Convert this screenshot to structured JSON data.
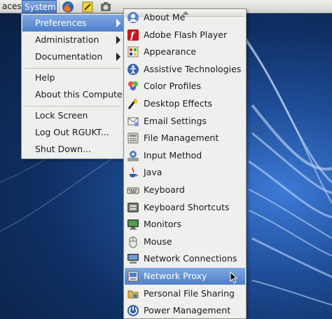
{
  "panel": {
    "places_label": "aces",
    "system_label": "System",
    "launchers": [
      {
        "name": "firefox-icon"
      },
      {
        "name": "text-editor-icon"
      },
      {
        "name": "screenshot-icon"
      }
    ]
  },
  "system_menu": {
    "items": [
      {
        "label": "Preferences",
        "submenu": true,
        "active": true
      },
      {
        "label": "Administration",
        "submenu": true
      },
      {
        "label": "Documentation",
        "submenu": true
      },
      {
        "label": "Help"
      },
      {
        "label": "About this Computer"
      },
      {
        "label": "Lock Screen"
      },
      {
        "label": "Log Out RGUKT..."
      },
      {
        "label": "Shut Down..."
      }
    ]
  },
  "preferences_menu": {
    "items": [
      {
        "label": "About Me",
        "icon": "about-me-icon"
      },
      {
        "label": "Adobe Flash Player",
        "icon": "flash-player-icon"
      },
      {
        "label": "Appearance",
        "icon": "appearance-icon"
      },
      {
        "label": "Assistive Technologies",
        "icon": "accessibility-icon"
      },
      {
        "label": "Color Profiles",
        "icon": "color-profiles-icon"
      },
      {
        "label": "Desktop Effects",
        "icon": "desktop-effects-icon"
      },
      {
        "label": "Email Settings",
        "icon": "email-settings-icon"
      },
      {
        "label": "File Management",
        "icon": "file-management-icon"
      },
      {
        "label": "Input Method",
        "icon": "input-method-icon"
      },
      {
        "label": "Java",
        "icon": "java-icon"
      },
      {
        "label": "Keyboard",
        "icon": "keyboard-icon"
      },
      {
        "label": "Keyboard Shortcuts",
        "icon": "keyboard-shortcuts-icon"
      },
      {
        "label": "Monitors",
        "icon": "monitors-icon"
      },
      {
        "label": "Mouse",
        "icon": "mouse-icon"
      },
      {
        "label": "Network Connections",
        "icon": "network-connections-icon"
      },
      {
        "label": "Network Proxy",
        "icon": "network-proxy-icon",
        "active": true
      },
      {
        "label": "Personal File Sharing",
        "icon": "file-sharing-icon"
      },
      {
        "label": "Power Management",
        "icon": "power-management-icon"
      }
    ]
  },
  "colors": {
    "highlight": "#5b89d3",
    "menu_bg": "#efefed",
    "desktop": "#1f4f9a"
  }
}
